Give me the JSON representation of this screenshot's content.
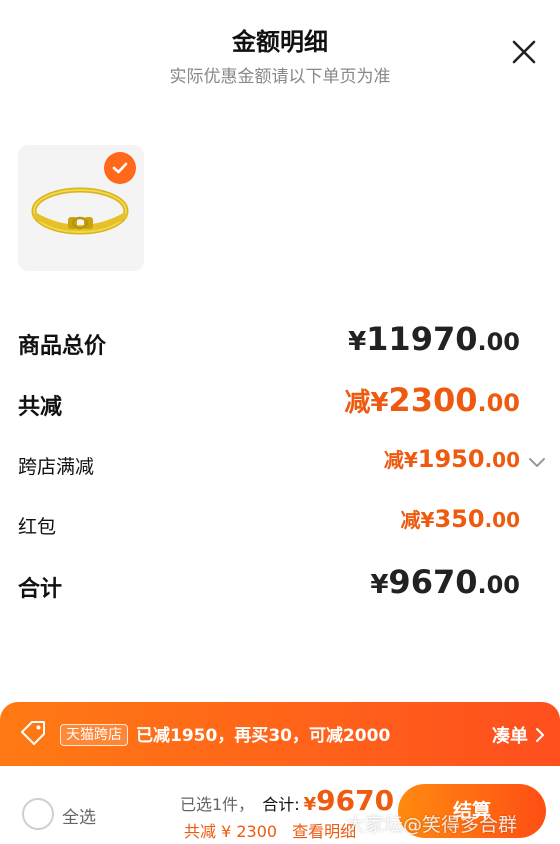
{
  "header": {
    "title": "金额明细",
    "subtitle": "实际优惠金额请以下单页为准"
  },
  "icons": {
    "close": "close-icon",
    "check": "check-icon",
    "chevron_down": "chevron-down-icon",
    "tag": "tag-icon",
    "chevron_right": "chevron-right-icon"
  },
  "colors": {
    "accent": "#ee5a10",
    "promo_bar_start": "#ff7a14",
    "promo_bar_end": "#ff4f1e"
  },
  "breakdown": {
    "total": {
      "label": "商品总价",
      "currency": "¥",
      "integer": "11970",
      "decimal": ".00"
    },
    "saved": {
      "label": "共减",
      "currency": "减¥",
      "integer": "2300",
      "decimal": ".00"
    },
    "cross_store": {
      "label": "跨店满减",
      "currency": "减¥",
      "integer": "1950",
      "decimal": ".00"
    },
    "red_packet": {
      "label": "红包",
      "currency": "减¥",
      "integer": "350",
      "decimal": ".00"
    },
    "sum": {
      "label": "合计",
      "currency": "¥",
      "integer": "9670",
      "decimal": ".00"
    }
  },
  "promo": {
    "store_tag": "天猫跨店",
    "text": "已减1950，再买30，可减2000",
    "link": "凑单"
  },
  "bottom": {
    "select_all": "全选",
    "selected": "已选1件，",
    "total_label": "合计:",
    "total_currency": "¥",
    "total_value": "9670",
    "saved_text": "共减 ¥ 2300",
    "view_detail": "查看明细",
    "checkout": "结算"
  },
  "watermark": "大家坛@笑得多合群"
}
